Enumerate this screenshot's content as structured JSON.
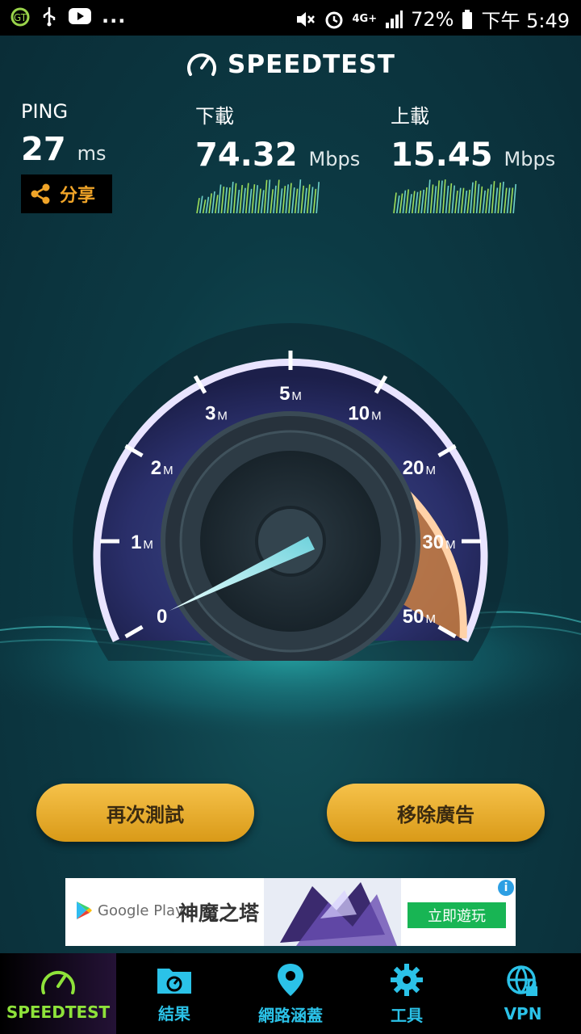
{
  "status_bar": {
    "left_icons": [
      "app-notification-icon",
      "usb-icon",
      "youtube-icon"
    ],
    "more": "...",
    "network": "4G+",
    "battery": "72%",
    "time": "下午 5:49"
  },
  "app": {
    "title": "SPEEDTEST"
  },
  "metrics": {
    "ping": {
      "label": "PING",
      "value": "27",
      "unit": "ms"
    },
    "download": {
      "label": "下載",
      "value": "74.32",
      "unit": "Mbps"
    },
    "upload": {
      "label": "上載",
      "value": "15.45",
      "unit": "Mbps"
    }
  },
  "share": {
    "label": "分享"
  },
  "gauge": {
    "ticks": [
      "0",
      "1",
      "2",
      "3",
      "5",
      "10",
      "20",
      "30",
      "50"
    ],
    "unit": "M"
  },
  "buttons": {
    "retest": "再次測試",
    "remove_ads": "移除廣告"
  },
  "ad": {
    "store": "Google Play",
    "title": "神魔之塔",
    "cta": "立即遊玩",
    "info": "i"
  },
  "nav": {
    "items": [
      {
        "label": "SPEEDTEST",
        "icon": "speedometer-icon",
        "active": true
      },
      {
        "label": "結果",
        "icon": "folder-icon",
        "active": false
      },
      {
        "label": "網路涵蓋",
        "icon": "map-pin-icon",
        "active": false
      },
      {
        "label": "工具",
        "icon": "gear-icon",
        "active": false
      },
      {
        "label": "VPN",
        "icon": "globe-lock-icon",
        "active": false
      }
    ]
  },
  "colors": {
    "accent_gold": "#f0a428",
    "nav_blue": "#2bc2e8",
    "nav_green": "#8ee23a",
    "gauge_orange": "#e08a3c"
  }
}
